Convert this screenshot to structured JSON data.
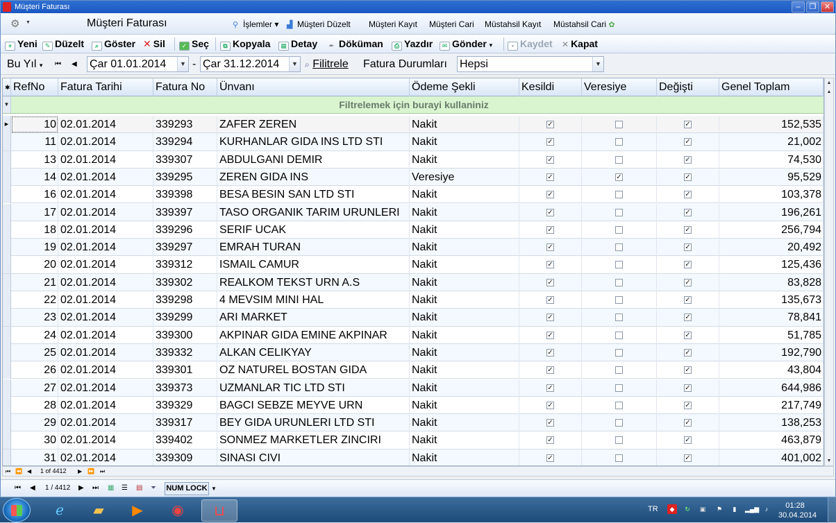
{
  "window": {
    "title": "Müşteri Faturası"
  },
  "menubar": {
    "form_title": "Müşteri Faturası",
    "items": [
      "İşlemler",
      "Müşteri Düzelt",
      "Müşteri Kayıt",
      "Müşteri Cari",
      "Müstahsil Kayıt",
      "Müstahsil Cari"
    ]
  },
  "toolbar": {
    "yeni": "Yeni",
    "duzelt": "Düzelt",
    "goster": "Göster",
    "sil": "Sil",
    "sec": "Seç",
    "kopyala": "Kopyala",
    "detay": "Detay",
    "dokuman": "Döküman",
    "yazdir": "Yazdır",
    "gonder": "Gönder",
    "kaydet": "Kaydet",
    "kapat": "Kapat"
  },
  "filterbar": {
    "period": "Bu Yıl",
    "date_start": "Çar 01.01.2014",
    "dash": "-",
    "date_end": "Çar 31.12.2014",
    "filter_button": "Filitrele",
    "status_label": "Fatura Durumları",
    "status_value": "Hepsi"
  },
  "grid": {
    "columns": [
      "RefNo",
      "Fatura Tarihi",
      "Fatura No",
      "Ünvanı",
      "Ödeme Şekli",
      "Kesildi",
      "Veresiye",
      "Değişti",
      "Genel Toplam"
    ],
    "filter_hint": "Filtrelemek için burayi kullaniniz",
    "rows": [
      {
        "ref": "10",
        "date": "02.01.2014",
        "no": "339293",
        "name": "ZAFER ZEREN",
        "pay": "Nakit",
        "kesildi": true,
        "veresiye": false,
        "degisti": true,
        "total": "152,535"
      },
      {
        "ref": "11",
        "date": "02.01.2014",
        "no": "339294",
        "name": "KURHANLAR GIDA INS LTD STI",
        "pay": "Nakit",
        "kesildi": true,
        "veresiye": false,
        "degisti": true,
        "total": "21,002"
      },
      {
        "ref": "13",
        "date": "02.01.2014",
        "no": "339307",
        "name": "ABDULGANI DEMIR",
        "pay": "Nakit",
        "kesildi": true,
        "veresiye": false,
        "degisti": true,
        "total": "74,530"
      },
      {
        "ref": "14",
        "date": "02.01.2014",
        "no": "339295",
        "name": "ZEREN GIDA INS",
        "pay": "Veresiye",
        "kesildi": true,
        "veresiye": true,
        "degisti": true,
        "total": "95,529"
      },
      {
        "ref": "16",
        "date": "02.01.2014",
        "no": "339398",
        "name": "BESA BESIN SAN LTD STI",
        "pay": "Nakit",
        "kesildi": true,
        "veresiye": false,
        "degisti": true,
        "total": "103,378"
      },
      {
        "ref": "17",
        "date": "02.01.2014",
        "no": "339397",
        "name": "TASO ORGANIK TARIM URUNLERI",
        "pay": "Nakit",
        "kesildi": true,
        "veresiye": false,
        "degisti": true,
        "total": "196,261"
      },
      {
        "ref": "18",
        "date": "02.01.2014",
        "no": "339296",
        "name": "SERIF UCAK",
        "pay": "Nakit",
        "kesildi": true,
        "veresiye": false,
        "degisti": true,
        "total": "256,794"
      },
      {
        "ref": "19",
        "date": "02.01.2014",
        "no": "339297",
        "name": "EMRAH TURAN",
        "pay": "Nakit",
        "kesildi": true,
        "veresiye": false,
        "degisti": true,
        "total": "20,492"
      },
      {
        "ref": "20",
        "date": "02.01.2014",
        "no": "339312",
        "name": "ISMAIL CAMUR",
        "pay": "Nakit",
        "kesildi": true,
        "veresiye": false,
        "degisti": true,
        "total": "125,436"
      },
      {
        "ref": "21",
        "date": "02.01.2014",
        "no": "339302",
        "name": "REALKOM TEKST URN A.S",
        "pay": "Nakit",
        "kesildi": true,
        "veresiye": false,
        "degisti": true,
        "total": "83,828"
      },
      {
        "ref": "22",
        "date": "02.01.2014",
        "no": "339298",
        "name": "4 MEVSIM MINI HAL",
        "pay": "Nakit",
        "kesildi": true,
        "veresiye": false,
        "degisti": true,
        "total": "135,673"
      },
      {
        "ref": "23",
        "date": "02.01.2014",
        "no": "339299",
        "name": "ARI MARKET",
        "pay": "Nakit",
        "kesildi": true,
        "veresiye": false,
        "degisti": true,
        "total": "78,841"
      },
      {
        "ref": "24",
        "date": "02.01.2014",
        "no": "339300",
        "name": "AKPINAR GIDA EMINE AKPINAR",
        "pay": "Nakit",
        "kesildi": true,
        "veresiye": false,
        "degisti": true,
        "total": "51,785"
      },
      {
        "ref": "25",
        "date": "02.01.2014",
        "no": "339332",
        "name": "ALKAN CELIKYAY",
        "pay": "Nakit",
        "kesildi": true,
        "veresiye": false,
        "degisti": true,
        "total": "192,790"
      },
      {
        "ref": "26",
        "date": "02.01.2014",
        "no": "339301",
        "name": "OZ NATUREL BOSTAN GIDA",
        "pay": "Nakit",
        "kesildi": true,
        "veresiye": false,
        "degisti": true,
        "total": "43,804"
      },
      {
        "ref": "27",
        "date": "02.01.2014",
        "no": "339373",
        "name": "UZMANLAR TIC LTD STI",
        "pay": "Nakit",
        "kesildi": true,
        "veresiye": false,
        "degisti": true,
        "total": "644,986"
      },
      {
        "ref": "28",
        "date": "02.01.2014",
        "no": "339329",
        "name": "BAGCI SEBZE MEYVE URN",
        "pay": "Nakit",
        "kesildi": true,
        "veresiye": false,
        "degisti": true,
        "total": "217,749"
      },
      {
        "ref": "29",
        "date": "02.01.2014",
        "no": "339317",
        "name": "BEY GIDA URUNLERI LTD STI",
        "pay": "Nakit",
        "kesildi": true,
        "veresiye": false,
        "degisti": true,
        "total": "138,253"
      },
      {
        "ref": "30",
        "date": "02.01.2014",
        "no": "339402",
        "name": "SONMEZ MARKETLER ZINCIRI",
        "pay": "Nakit",
        "kesildi": true,
        "veresiye": false,
        "degisti": true,
        "total": "463,879"
      },
      {
        "ref": "31",
        "date": "02.01.2014",
        "no": "339309",
        "name": "SINASI CIVI",
        "pay": "Nakit",
        "kesildi": true,
        "veresiye": false,
        "degisti": true,
        "total": "401,002"
      }
    ]
  },
  "navbar": {
    "position": "1 of 4412"
  },
  "statusbar": {
    "record": "1 / 4412",
    "numlock": "NUM LOCK"
  },
  "taskbar": {
    "lang": "TR",
    "time": "01:28",
    "date": "30.04.2014"
  }
}
